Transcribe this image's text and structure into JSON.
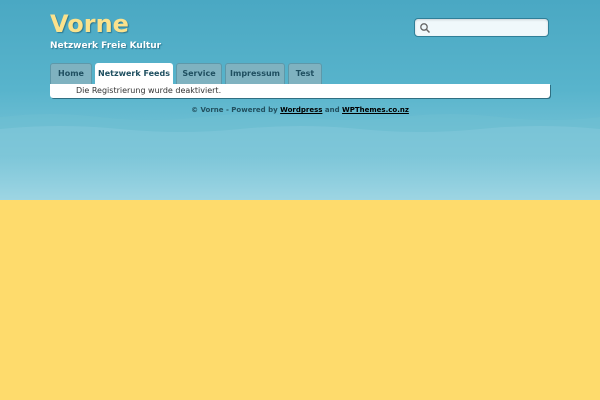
{
  "site": {
    "title": "Vorne",
    "tagline": "Netzwerk Freie Kultur"
  },
  "search": {
    "placeholder": "",
    "value": ""
  },
  "nav": {
    "tabs": [
      {
        "label": "Home",
        "active": false
      },
      {
        "label": "Netzwerk Feeds",
        "active": true
      },
      {
        "label": "Service",
        "active": false
      },
      {
        "label": "Impressum",
        "active": false
      },
      {
        "label": "Test",
        "active": false
      }
    ]
  },
  "main": {
    "notice": "Die Registrierung wurde deaktiviert."
  },
  "footer": {
    "prefix": "© Vorne - Powered by ",
    "link1": "Wordpress",
    "middle": " and ",
    "link2": "WPThemes.co.nz"
  },
  "colors": {
    "sky_top": "#4aa8c3",
    "sky_bottom": "#9dd5e3",
    "sand": "#fedb6c",
    "title": "#fbe28c",
    "tab": "#7fb2c0"
  }
}
